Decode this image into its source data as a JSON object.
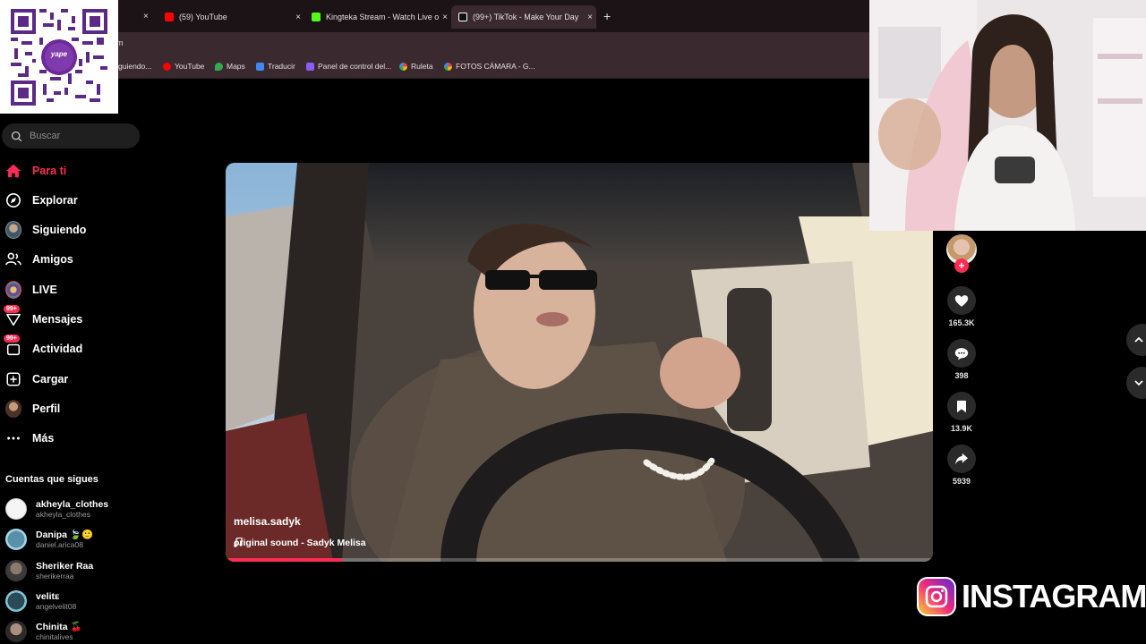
{
  "browser": {
    "tabs": [
      {
        "label": "(59) YouTube",
        "color": "#ff0000"
      },
      {
        "label": "Kingteka Stream - Watch Live o",
        "color": "#53fc18"
      },
      {
        "label": "(99+) TikTok - Make Your Day",
        "color": "#ffffff",
        "active": true
      }
    ],
    "close_glyph": "×",
    "new_tab_glyph": "+",
    "address_fragment": "m",
    "bookmarks": [
      {
        "label": "guiendo...",
        "icon": "tiktok-icon"
      },
      {
        "label": "YouTube",
        "icon": "youtube-icon"
      },
      {
        "label": "Maps",
        "icon": "maps-icon"
      },
      {
        "label": "Traducir",
        "icon": "translate-icon"
      },
      {
        "label": "Panel de control del...",
        "icon": "panel-icon"
      },
      {
        "label": "Ruleta",
        "icon": "roulette-icon"
      },
      {
        "label": "FOTOS CÁMARA - G...",
        "icon": "photos-icon"
      }
    ]
  },
  "qr": {
    "brand": "yape"
  },
  "sidebar": {
    "search_placeholder": "Buscar",
    "nav": [
      {
        "label": "Para ti",
        "icon": "home-icon",
        "active": true
      },
      {
        "label": "Explorar",
        "icon": "compass-icon"
      },
      {
        "label": "Siguiendo",
        "icon": "following-avatar-icon"
      },
      {
        "label": "Amigos",
        "icon": "friends-icon"
      },
      {
        "label": "LIVE",
        "icon": "live-icon"
      },
      {
        "label": "Mensajes",
        "icon": "messages-icon",
        "badge": "99+"
      },
      {
        "label": "Actividad",
        "icon": "activity-icon",
        "badge": "99+"
      },
      {
        "label": "Cargar",
        "icon": "upload-icon"
      },
      {
        "label": "Perfil",
        "icon": "profile-avatar-icon"
      },
      {
        "label": "Más",
        "icon": "more-icon"
      }
    ],
    "following_title": "Cuentas que sigues",
    "accounts": [
      {
        "name": "akheyla_clothes",
        "username": "akheyla_clothes"
      },
      {
        "name": "Danipa 🍃🙂",
        "username": "daniel.arica08"
      },
      {
        "name": "Sheriker Raa",
        "username": "sherikerraa"
      },
      {
        "name": "velitᴇ",
        "username": "angelvelit08"
      },
      {
        "name": "Chinita 🍒",
        "username": "chinitalives"
      }
    ]
  },
  "video": {
    "author": "melisa.sadyk",
    "sound": "original sound - Sadyk Melisa",
    "progress": 0.165
  },
  "actions": {
    "likes": "165.3K",
    "comments": "398",
    "saves": "13.9K",
    "shares": "5939"
  },
  "overlay": {
    "instagram_text": "INSTAGRAM"
  },
  "colors": {
    "accent": "#fe2c55",
    "tab_bar": "#1b1316",
    "toolbar": "#3a2a30"
  }
}
